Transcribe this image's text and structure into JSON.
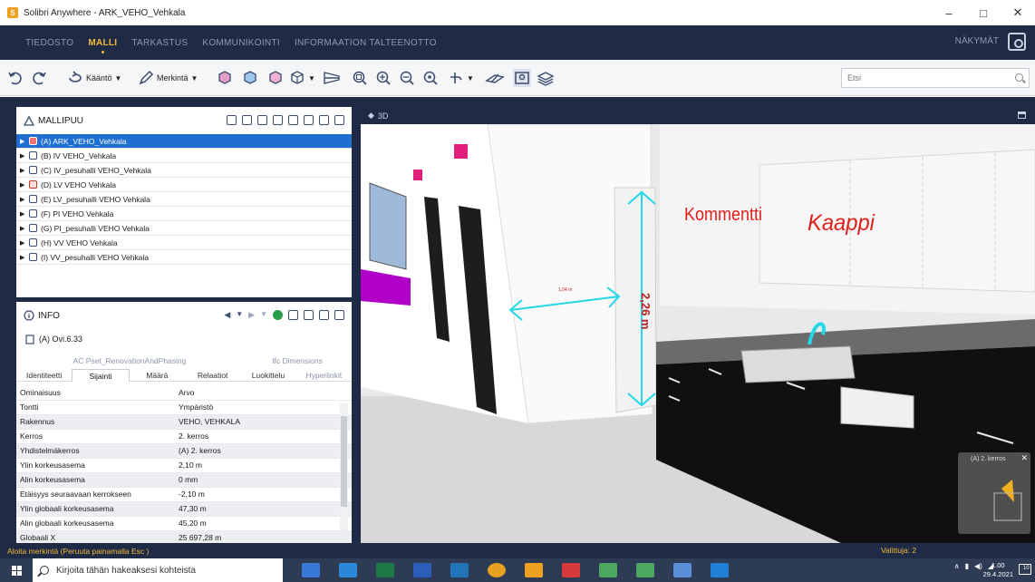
{
  "window": {
    "title": "Solibri Anywhere - ARK_VEHO_Vehkala",
    "app_icon_letter": "S",
    "minimize": "–",
    "restore": "□",
    "close": "✕"
  },
  "menu": {
    "items": [
      "TIEDOSTO",
      "MALLI",
      "TARKASTUS",
      "KOMMUNIKOINTI",
      "INFORMAATION TALTEENOTTO"
    ],
    "active": "MALLI",
    "views_label": "NÄKYMÄT"
  },
  "toolbar": {
    "rotate_label": "Kääntö",
    "markup_label": "Merkintä",
    "search_placeholder": "Etsi"
  },
  "model_tree": {
    "title": "MALLIPUU",
    "items": [
      {
        "label": "(A) ARK_VEHO_Vehkala",
        "selected": true
      },
      {
        "label": "(B) IV VEHO_Vehkala"
      },
      {
        "label": "(C) IV_pesuhalli VEHO_Vehkala"
      },
      {
        "label": "(D) LV VEHO Vehkala",
        "red": true
      },
      {
        "label": "(E) LV_pesuhalli VEHO Vehkala"
      },
      {
        "label": "(F) PI VEHO Vehkala"
      },
      {
        "label": "(G) PI_pesuhalli VEHO Vehkala"
      },
      {
        "label": "(H) VV VEHO Vehkala"
      },
      {
        "label": "(I) VV_pesuhalli VEHO Vehkala"
      }
    ]
  },
  "info": {
    "title": "INFO",
    "object": "(A) Ovi.6.33",
    "tab_groups": [
      "AC Pset_RenovationAndPhasing",
      "Ifc Dimensions"
    ],
    "tabs": [
      "Identiteetti",
      "Sijainti",
      "Määrä",
      "Relaatiot",
      "Luokittelu",
      "Hyperlinkit"
    ],
    "active_tab": "Sijainti",
    "columns": [
      "Ominaisuus",
      "Arvo"
    ],
    "rows": [
      [
        "Tontti",
        "Ympäristö"
      ],
      [
        "Rakennus",
        "VEHO, VEHKALA"
      ],
      [
        "Kerros",
        "2. kerros"
      ],
      [
        "Yhdistelmäkerros",
        "(A) 2. kerros"
      ],
      [
        "Ylin korkeusasema",
        "2,10 m"
      ],
      [
        "Alin korkeusasema",
        "0 mm"
      ],
      [
        "Etäisyys seuraavaan kerrokseen",
        "-2,10 m"
      ],
      [
        "Ylin globaali korkeusasema",
        "47,30 m"
      ],
      [
        "Alin globaali korkeusasema",
        "45,20 m"
      ],
      [
        "Globaali X",
        "25 697,28 m"
      ]
    ]
  },
  "viewport": {
    "title": "3D",
    "annotation_comment": "Kommentti",
    "annotation_cabinet": "Kaappi",
    "dim_vertical": "2,26 m",
    "dim_horizontal": "1,04 m",
    "minimap_label": "(A) 2. kerros"
  },
  "status": {
    "left": "Aloita merkintä (Peruuta painamalla Esc )",
    "right": "Valittuja: 2"
  },
  "taskbar": {
    "search_placeholder": "Kirjoita tähän hakeaksesi kohteista",
    "time": "1.00",
    "date": "29.4.2021",
    "notification_count": "10"
  },
  "colors": {
    "navy": "#1f2a44",
    "accent": "#f3b93c",
    "selection": "#1e6fd0",
    "annotation": "#e0201a",
    "dimension_line": "#22d8e6"
  }
}
